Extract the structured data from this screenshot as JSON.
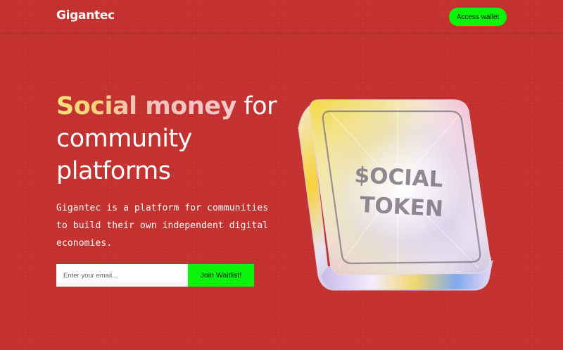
{
  "header": {
    "logo": "Gigantec",
    "wallet_button": "Access wallet"
  },
  "hero": {
    "headline_part1": "Social money",
    "headline_part2": " for community platforms",
    "description": "Gigantec is a platform for communities to build their own independent digital economies.",
    "email_placeholder": "Enter your email...",
    "join_button": "Join Waitlist!"
  },
  "token": {
    "line1": "$OCIAL",
    "line2": "TOKEN"
  },
  "colors": {
    "background": "#c4302e",
    "accent_green": "#0bf50b"
  }
}
